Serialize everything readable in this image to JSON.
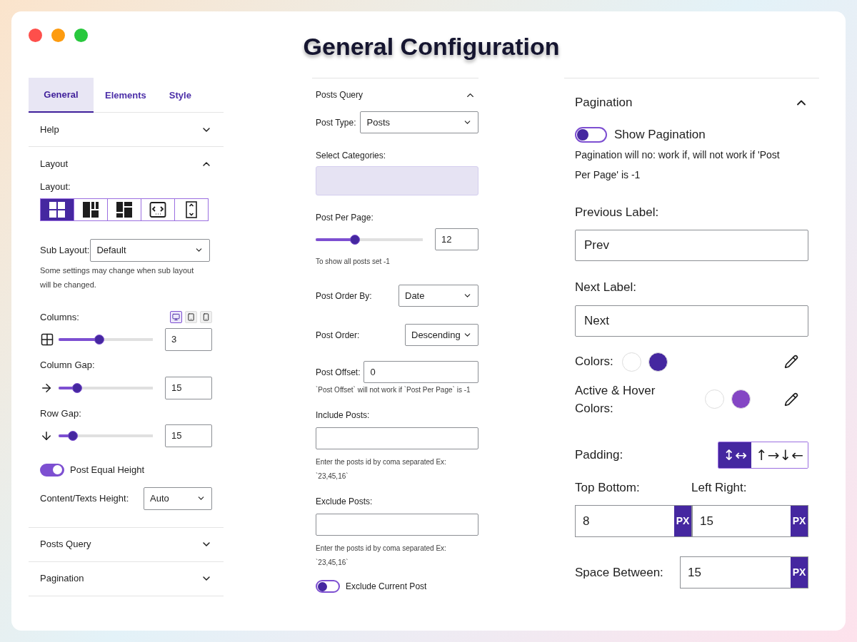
{
  "window": {
    "title": "General Configuration"
  },
  "left_panel": {
    "tabs": [
      {
        "label": "General",
        "selected": true
      },
      {
        "label": "Elements",
        "selected": false
      },
      {
        "label": "Style",
        "selected": false
      }
    ],
    "help": {
      "title": "Help",
      "expanded": false
    },
    "layout": {
      "title": "Layout",
      "expanded": true,
      "layout_label": "Layout:",
      "layout_options": [
        {
          "kind": "grid",
          "selected": true
        },
        {
          "kind": "columns",
          "selected": false
        },
        {
          "kind": "masonry",
          "selected": false
        },
        {
          "kind": "carousel",
          "selected": false
        },
        {
          "kind": "vertical",
          "selected": false
        }
      ],
      "sub_layout": {
        "label": "Sub Layout:",
        "value": "Default"
      },
      "sub_layout_note": "Some settings may change when sub layout will be changed.",
      "columns_label": "Columns:",
      "devices": [
        {
          "kind": "desktop",
          "selected": true
        },
        {
          "kind": "tablet",
          "selected": false
        },
        {
          "kind": "mobile",
          "selected": false
        }
      ],
      "sliders": [
        {
          "kind": "columns",
          "level": 0.42,
          "value": "3"
        },
        {
          "kind": "column_gap",
          "label": "Column Gap:",
          "level": 0.16,
          "value": "15"
        },
        {
          "kind": "row_gap",
          "label": "Row Gap:",
          "level": 0.11,
          "value": "15"
        }
      ],
      "equal_height": {
        "label": "Post Equal Height",
        "on": true
      },
      "content_height": {
        "label": "Content/Texts Height:",
        "value": "Auto"
      }
    },
    "collapsed_sections": [
      {
        "title": "Posts Query",
        "expanded": false
      },
      {
        "title": "Pagination",
        "expanded": false
      }
    ]
  },
  "posts_query": {
    "title": "Posts Query",
    "expanded": true,
    "post_type": {
      "label": "Post Type:",
      "value": "Posts"
    },
    "categories_label": "Select Categories:",
    "per_page": {
      "label": "Post Per Page:",
      "level": 0.35,
      "value": "12",
      "note": "To show all posts set -1"
    },
    "order_by": {
      "label": "Post Order By:",
      "value": "Date"
    },
    "order": {
      "label": "Post Order:",
      "value": "Descending"
    },
    "offset": {
      "label": "Post Offset:",
      "value": "0",
      "note": "`Post Offset` will not work if `Post Per Page` is -1"
    },
    "include": {
      "label": "Include Posts:",
      "note": "Enter the posts id by coma separated Ex: `23,45,16`"
    },
    "exclude": {
      "label": "Exclude Posts:",
      "note": "Enter the posts id by coma separated Ex: `23,45,16`"
    },
    "exclude_current": {
      "label": "Exclude Current Post",
      "on": false
    }
  },
  "pagination": {
    "title": "Pagination",
    "expanded": true,
    "show_pagination": {
      "label": "Show Pagination",
      "on": false
    },
    "note": "Pagination will no: work if, will not work if 'Post Per Page' is -1",
    "previous_label": {
      "label": "Previous Label:",
      "value": "Prev"
    },
    "next_label": {
      "label": "Next Label:",
      "value": "Next"
    },
    "colors": {
      "label": "Colors:",
      "swatches": [
        {
          "color": "#ffffff"
        },
        {
          "color": "#4527a0"
        }
      ]
    },
    "active_hover_colors": {
      "label": "Active & Hover Colors:",
      "swatches": [
        {
          "color": "#ffffff"
        },
        {
          "color": "#8446c4"
        }
      ]
    },
    "padding": {
      "label": "Padding:",
      "modes": [
        {
          "label": "↕↔",
          "selected": true
        },
        {
          "label": "↑→↓←",
          "selected": false
        }
      ]
    },
    "top_bottom": {
      "label": "Top Bottom:",
      "value": "8",
      "unit": "PX"
    },
    "left_right": {
      "label": "Left Right:",
      "value": "15",
      "unit": "PX"
    },
    "space_between": {
      "label": "Space Between:",
      "value": "15",
      "unit": "PX"
    }
  }
}
